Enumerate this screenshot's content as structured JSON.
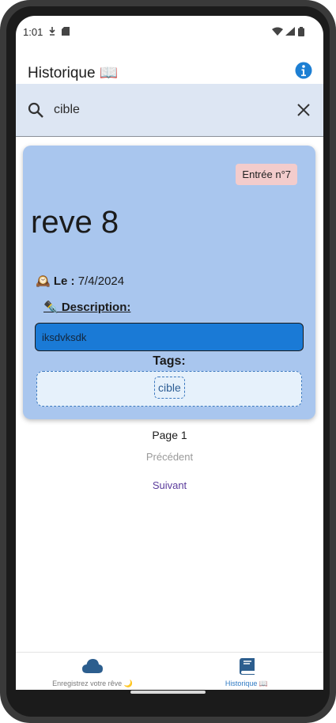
{
  "status": {
    "time": "1:01"
  },
  "appbar": {
    "title": "Historique 📖"
  },
  "search": {
    "value": "cible"
  },
  "entry": {
    "badge": "Entrée n°7",
    "title": "reve 8",
    "date_icon": "🕰️",
    "date_label": "Le :",
    "date_value": "7/4/2024",
    "description_label": "✒️ Description:",
    "description_text": "iksdvksdk",
    "tags_label": "Tags:",
    "tags": [
      "cible"
    ]
  },
  "pager": {
    "page_label": "Page 1",
    "prev_label": "Précédent",
    "next_label": "Suivant"
  },
  "nav": {
    "left_label": "Enregistrez votre rêve 🌙",
    "right_label": "Historique 📖",
    "left_icon": "cloud-icon",
    "right_icon": "book-icon"
  },
  "colors": {
    "card": "#a9c6ee",
    "badge": "#f3cccc",
    "description_box": "#1a7ad6",
    "search_bar": "#dde6f3",
    "nav_active": "#2e79c3",
    "next_button": "#5b3c9c"
  }
}
